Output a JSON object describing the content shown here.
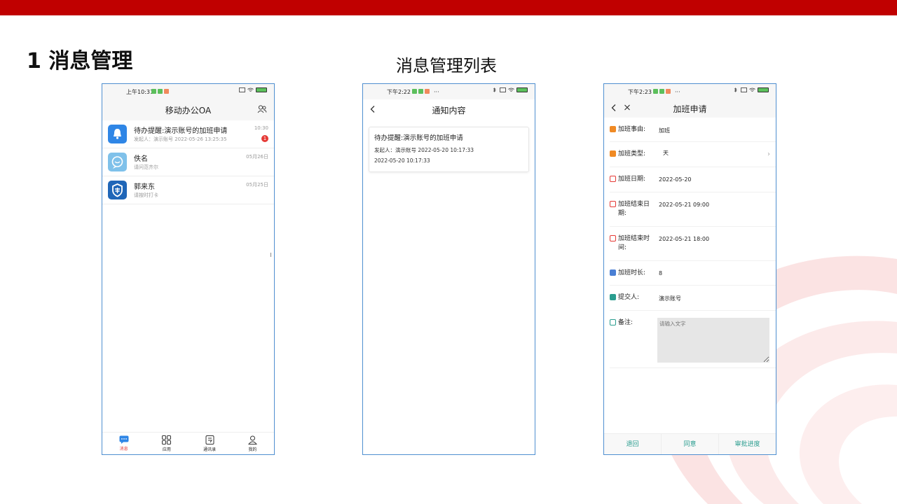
{
  "slide": {
    "title": "1 消息管理",
    "subtitle": "消息管理列表"
  },
  "colors": {
    "brand_red": "#c00000",
    "accent_blue": "#2f86e6",
    "action_green": "#2a9d8f",
    "frame_blue": "#4f8fd0"
  },
  "phone1": {
    "status_time": "上午10:31",
    "nav_title": "移动办公OA",
    "messages": [
      {
        "title": "待办提醒:演示账号的加班申请",
        "sub": "发起人：演示账号   2022-05-26 13:25:35",
        "time": "10:30",
        "badge": "1",
        "icon": "bell-icon"
      },
      {
        "title": "佚名",
        "sub": "请问范齐尔",
        "time": "05月26日",
        "icon": "chat-bubble-icon"
      },
      {
        "title": "郭来东",
        "sub": "请按时打卡",
        "time": "05月25日",
        "icon": "shield-security-icon"
      }
    ],
    "tabs": [
      {
        "label": "消息",
        "icon": "message-icon"
      },
      {
        "label": "应用",
        "icon": "grid-icon"
      },
      {
        "label": "通讯录",
        "icon": "contacts-icon"
      },
      {
        "label": "我的",
        "icon": "user-icon"
      }
    ]
  },
  "phone2": {
    "status_time": "下午2:22",
    "nav_title": "通知内容",
    "card": {
      "title": "待办提醒:演示账号的加班申请",
      "line1": "发起人：演示账号   2022-05-20 10:17:33",
      "line2": "2022-05-20 10:17:33"
    }
  },
  "phone3": {
    "status_time": "下午2:23",
    "nav_title": "加班申请",
    "fields": [
      {
        "label": "加班事由:",
        "value": "加班"
      },
      {
        "label": "加班类型:",
        "value": "天"
      },
      {
        "label": "加班日期:",
        "value": "2022-05-20"
      },
      {
        "label": "加班结束日期:",
        "value": "2022-05-21 09:00"
      },
      {
        "label": "加班结束时间:",
        "value": "2022-05-21 18:00"
      },
      {
        "label": "加班时长:",
        "value": "8"
      },
      {
        "label": "提交人:",
        "value": "演示账号"
      },
      {
        "label": "备注:",
        "value": ""
      }
    ],
    "remark_placeholder": "请输入文字",
    "actions": [
      "退回",
      "同意",
      "审批进度"
    ]
  }
}
